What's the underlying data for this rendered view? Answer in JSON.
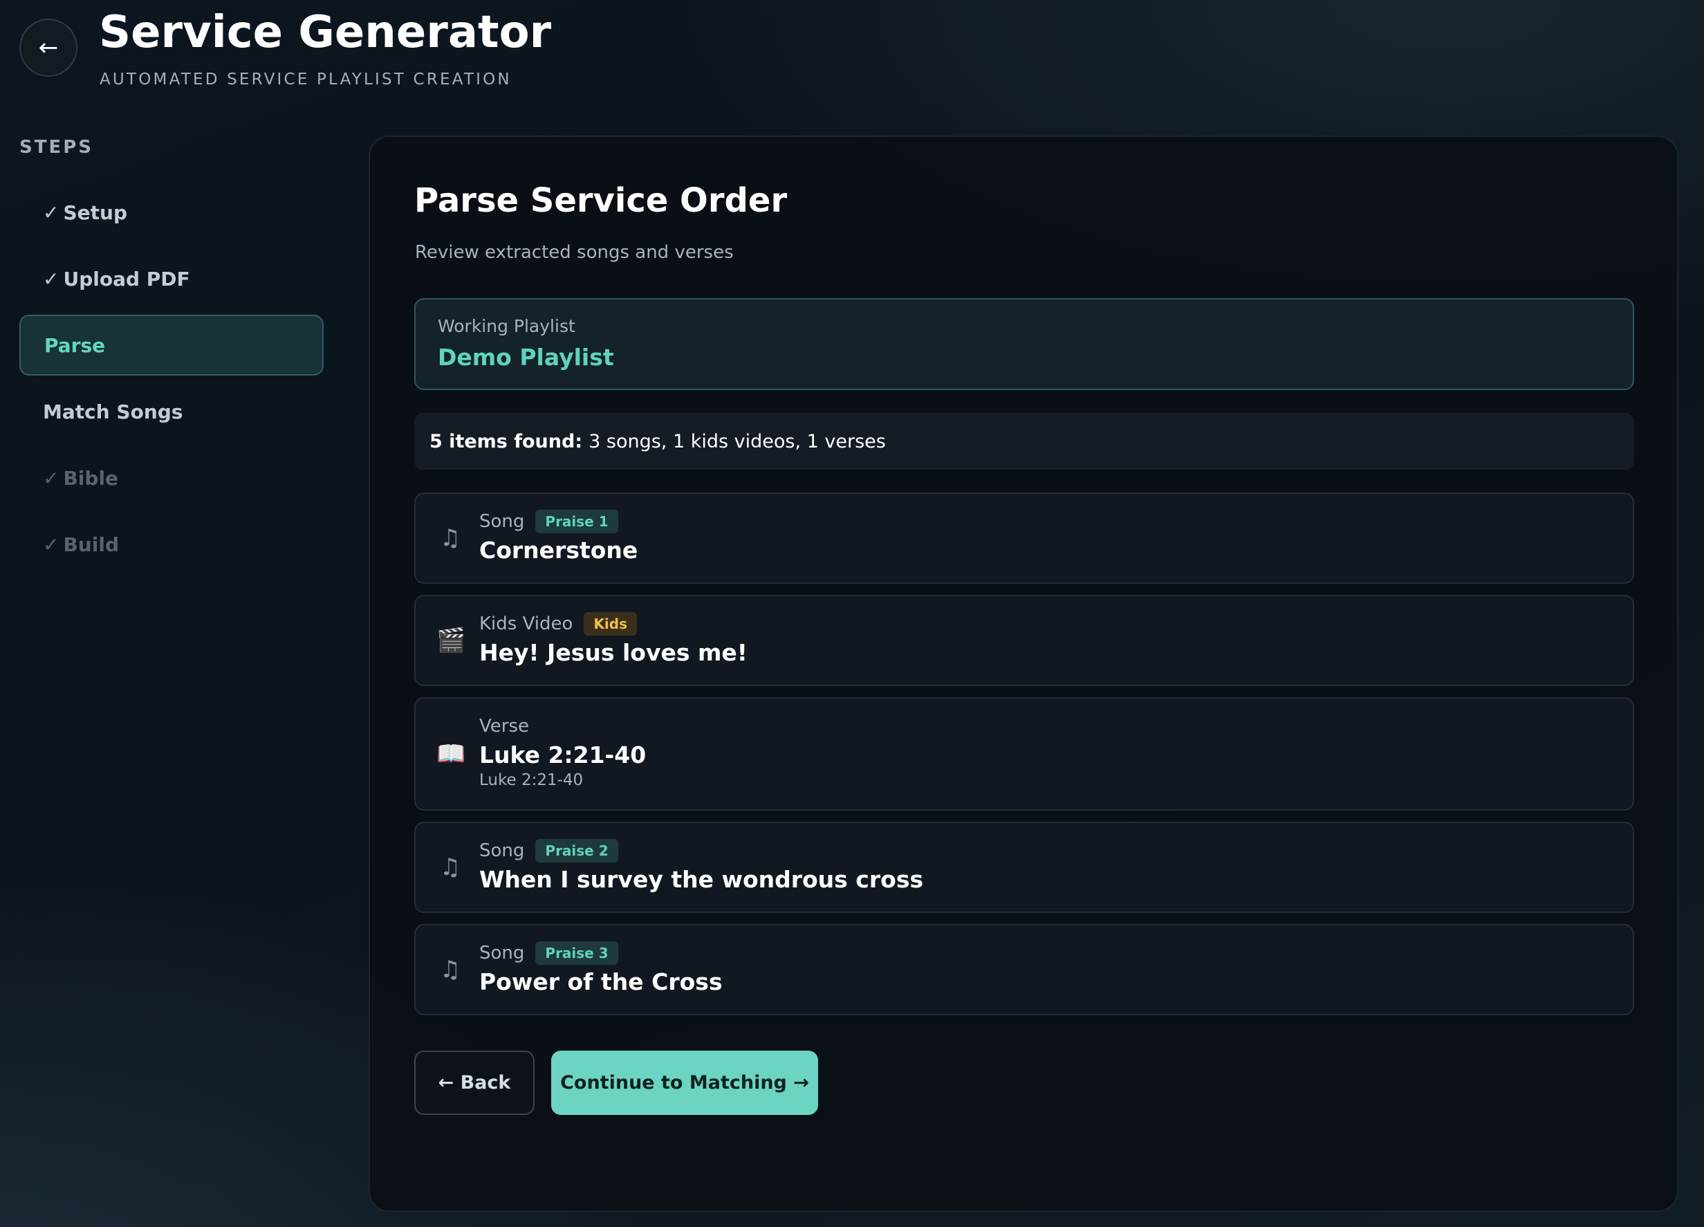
{
  "header": {
    "back_icon": "←",
    "title": "Service Generator",
    "subtitle": "AUTOMATED SERVICE PLAYLIST CREATION"
  },
  "sidebar": {
    "heading": "STEPS",
    "check_mark": "✓",
    "items": [
      {
        "label": "Setup",
        "state": "done"
      },
      {
        "label": "Upload PDF",
        "state": "done"
      },
      {
        "label": "Parse",
        "state": "active"
      },
      {
        "label": "Match Songs",
        "state": "pending"
      },
      {
        "label": "Bible",
        "state": "done-dim"
      },
      {
        "label": "Build",
        "state": "done-dim"
      }
    ]
  },
  "main": {
    "title": "Parse Service Order",
    "subtitle": "Review extracted songs and verses",
    "playlist": {
      "label": "Working Playlist",
      "name": "Demo Playlist"
    },
    "summary": {
      "bold": "5 items found:",
      "rest": "3 songs, 1 kids videos, 1 verses"
    },
    "items": [
      {
        "icon": "music-note-icon",
        "glyph": "♫",
        "type": "Song",
        "badge": "Praise 1",
        "title": "Cornerstone"
      },
      {
        "icon": "clapperboard-icon",
        "glyph": "🎬",
        "type": "Kids Video",
        "badge": "Kids",
        "title": "Hey! Jesus loves me!"
      },
      {
        "icon": "open-book-icon",
        "glyph": "📖",
        "type": "Verse",
        "title": "Luke 2:21-40",
        "reference": "Luke 2:21-40"
      },
      {
        "icon": "music-note-icon",
        "glyph": "♫",
        "type": "Song",
        "badge": "Praise 2",
        "title": "When I survey the wondrous cross"
      },
      {
        "icon": "music-note-icon",
        "glyph": "♫",
        "type": "Song",
        "badge": "Praise 3",
        "title": "Power of the Cross"
      }
    ],
    "buttons": {
      "back": "← Back",
      "continue": "Continue to Matching →"
    }
  },
  "colors": {
    "accent": "#6cd4c2",
    "badge_gold": "#f1c04b",
    "background": "#0c141c"
  }
}
